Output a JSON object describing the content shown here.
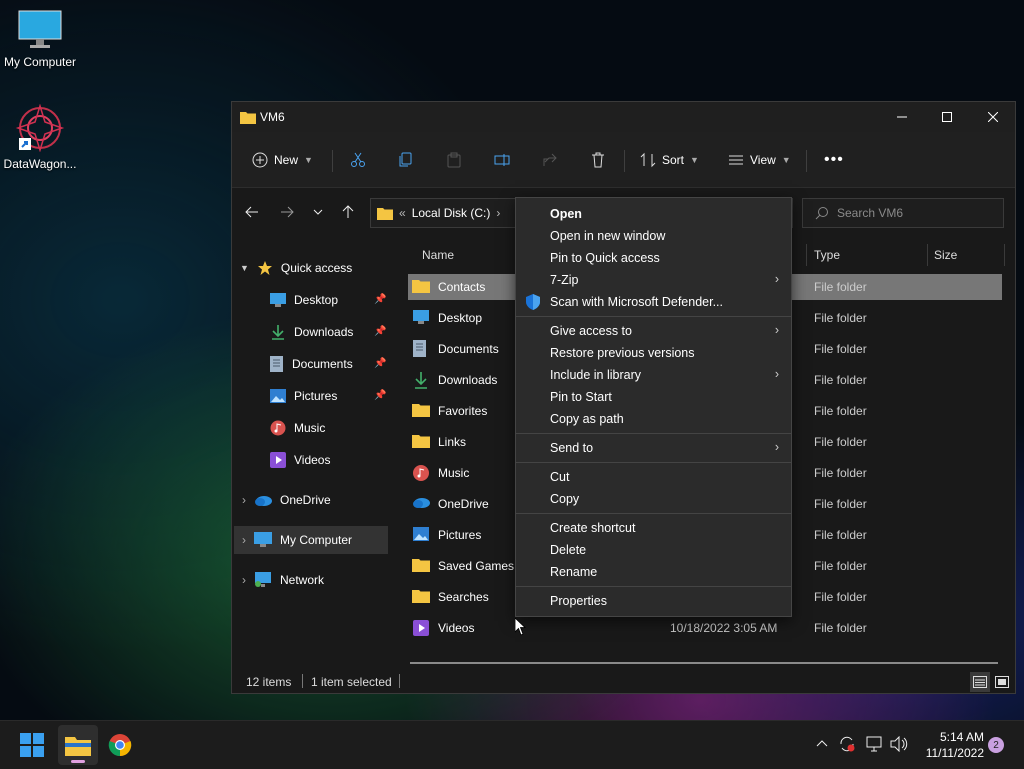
{
  "desktop": {
    "icons": [
      {
        "label": "My Computer"
      },
      {
        "label": "DataWagon..."
      }
    ]
  },
  "window": {
    "title": "VM6",
    "toolbar": {
      "new_label": "New",
      "sort_label": "Sort",
      "view_label": "View"
    },
    "address": {
      "prefix": "«",
      "path": "Local Disk (C:)"
    },
    "search": {
      "placeholder": "Search VM6"
    },
    "sidebar": {
      "quick_access": "Quick access",
      "items": [
        {
          "label": "Desktop",
          "pinned": true
        },
        {
          "label": "Downloads",
          "pinned": true
        },
        {
          "label": "Documents",
          "pinned": true
        },
        {
          "label": "Pictures",
          "pinned": true
        },
        {
          "label": "Music",
          "pinned": false
        },
        {
          "label": "Videos",
          "pinned": false
        }
      ],
      "onedrive": "OneDrive",
      "my_computer": "My Computer",
      "network": "Network"
    },
    "columns": {
      "name": "Name",
      "type": "Type",
      "size": "Size"
    },
    "files": [
      {
        "name": "Contacts",
        "date": "",
        "type": "File folder",
        "icon": "folder-icon"
      },
      {
        "name": "Desktop",
        "date": "",
        "type": "File folder",
        "icon": "desktop-icon"
      },
      {
        "name": "Documents",
        "date": "",
        "type": "File folder",
        "icon": "documents-icon"
      },
      {
        "name": "Downloads",
        "date": "",
        "type": "File folder",
        "icon": "downloads-icon"
      },
      {
        "name": "Favorites",
        "date": "",
        "type": "File folder",
        "icon": "folder-icon"
      },
      {
        "name": "Links",
        "date": "",
        "type": "File folder",
        "icon": "folder-icon"
      },
      {
        "name": "Music",
        "date": "",
        "type": "File folder",
        "icon": "music-icon"
      },
      {
        "name": "OneDrive",
        "date": "",
        "type": "File folder",
        "icon": "onedrive-icon"
      },
      {
        "name": "Pictures",
        "date": "",
        "type": "File folder",
        "icon": "pictures-icon"
      },
      {
        "name": "Saved Games",
        "date": "",
        "type": "File folder",
        "icon": "folder-icon"
      },
      {
        "name": "Searches",
        "date": "",
        "type": "File folder",
        "icon": "folder-icon"
      },
      {
        "name": "Videos",
        "date": "10/18/2022 3:05 AM",
        "type": "File folder",
        "icon": "videos-icon"
      }
    ],
    "status": {
      "items": "12 items",
      "selected": "1 item selected"
    }
  },
  "context_menu": {
    "items": [
      {
        "label": "Open",
        "bold": true,
        "submenu": false
      },
      {
        "label": "Open in new window",
        "submenu": false
      },
      {
        "label": "Pin to Quick access",
        "submenu": false
      },
      {
        "label": "7-Zip",
        "submenu": true
      },
      {
        "label": "Scan with Microsoft Defender...",
        "submenu": false,
        "icon": "defender-shield-icon"
      },
      {
        "label": "Give access to",
        "submenu": true
      },
      {
        "label": "Restore previous versions",
        "submenu": false
      },
      {
        "label": "Include in library",
        "submenu": true
      },
      {
        "label": "Pin to Start",
        "submenu": false
      },
      {
        "label": "Copy as path",
        "submenu": false
      },
      {
        "label": "Send to",
        "submenu": true
      },
      {
        "label": "Cut",
        "submenu": false
      },
      {
        "label": "Copy",
        "submenu": false
      },
      {
        "label": "Create shortcut",
        "submenu": false
      },
      {
        "label": "Delete",
        "submenu": false
      },
      {
        "label": "Rename",
        "submenu": false
      },
      {
        "label": "Properties",
        "submenu": false
      }
    ],
    "arrow": "›"
  },
  "taskbar": {
    "time": "5:14 AM",
    "date": "11/11/2022",
    "notification_count": "2"
  },
  "colors": {
    "accent": "#0078d4",
    "folder": "#f4c542",
    "selection": "#777777"
  }
}
